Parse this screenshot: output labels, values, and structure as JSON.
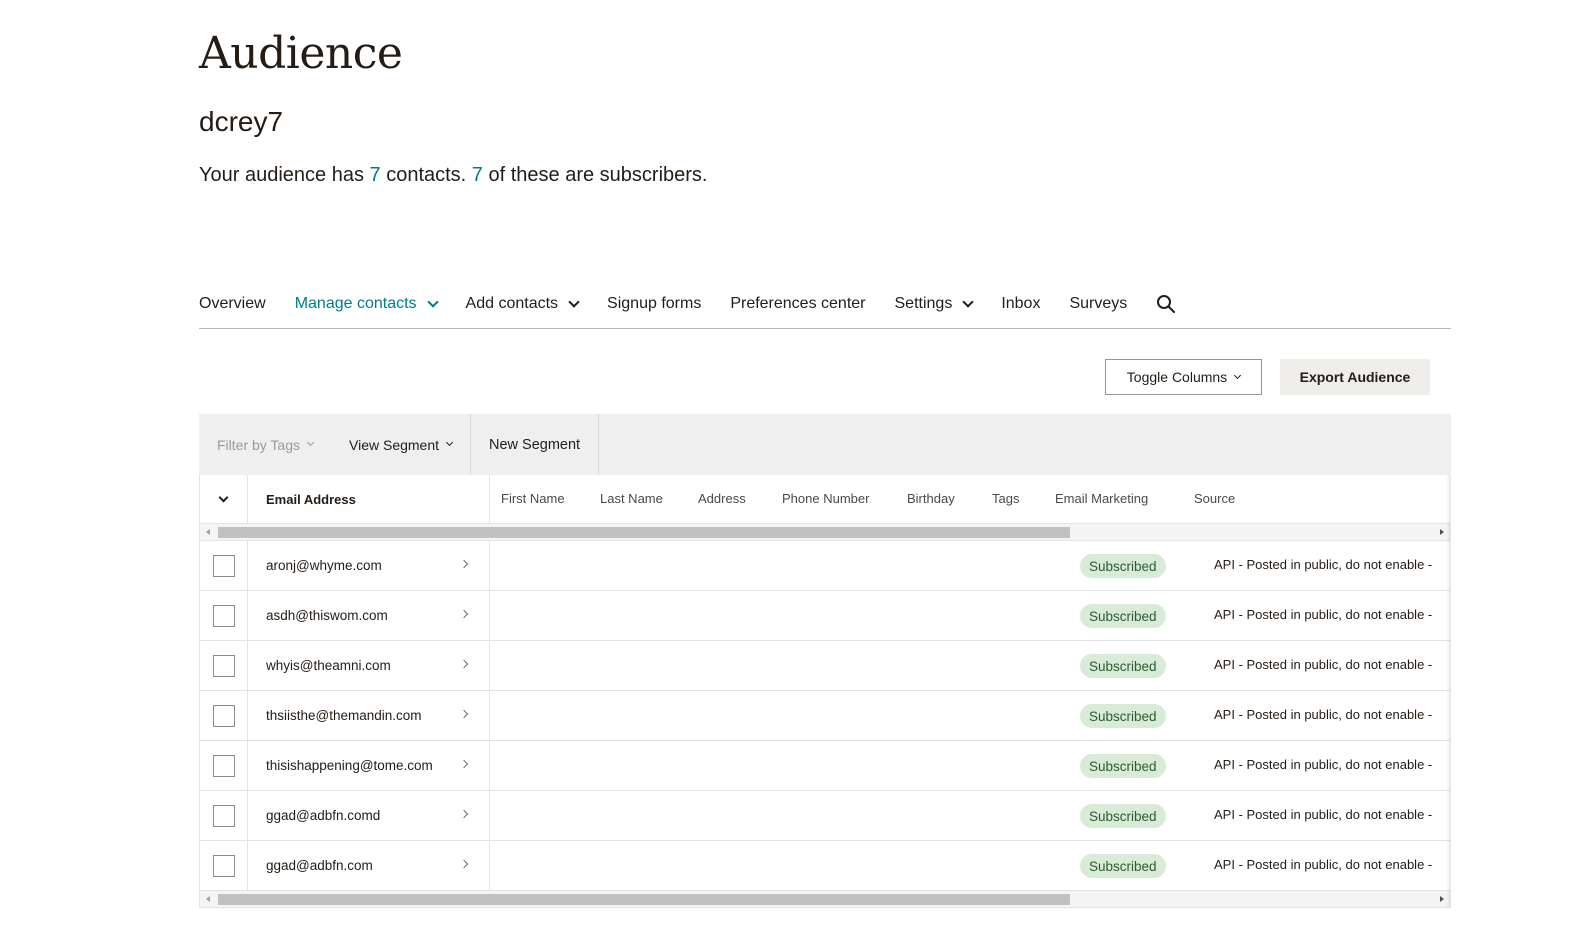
{
  "header": {
    "title": "Audience",
    "audience_name": "dcrey7",
    "summary": {
      "prefix": "Your audience has ",
      "contacts_count": "7",
      "middle": " contacts. ",
      "subscribers_count": "7",
      "suffix": " of these are subscribers."
    },
    "accent_color": "#007c89"
  },
  "nav": {
    "overview": "Overview",
    "manage_contacts": "Manage contacts",
    "add_contacts": "Add contacts",
    "signup_forms": "Signup forms",
    "preferences_center": "Preferences center",
    "settings": "Settings",
    "inbox": "Inbox",
    "surveys": "Surveys",
    "search_icon": "search-icon"
  },
  "toolbar": {
    "toggle_columns": "Toggle Columns",
    "export_audience": "Export Audience"
  },
  "filters": {
    "filter_by_tags": "Filter by Tags",
    "view_segment": "View Segment",
    "new_segment": "New Segment"
  },
  "table": {
    "columns": {
      "email": "Email Address",
      "first_name": "First Name",
      "last_name": "Last Name",
      "address": "Address",
      "phone": "Phone Number",
      "birthday": "Birthday",
      "tags": "Tags",
      "email_marketing": "Email Marketing",
      "source": "Source"
    },
    "rows": [
      {
        "email": "aronj@whyme.com",
        "status": "Subscribed",
        "source": "API - Posted in public, do not enable -"
      },
      {
        "email": "asdh@thiswom.com",
        "status": "Subscribed",
        "source": "API - Posted in public, do not enable -"
      },
      {
        "email": "whyis@theamni.com",
        "status": "Subscribed",
        "source": "API - Posted in public, do not enable -"
      },
      {
        "email": "thsiisthe@themandin.com",
        "status": "Subscribed",
        "source": "API - Posted in public, do not enable -"
      },
      {
        "email": "thisishappening@tome.com",
        "status": "Subscribed",
        "source": "API - Posted in public, do not enable -"
      },
      {
        "email": "ggad@adbfn.comd",
        "status": "Subscribed",
        "source": "API - Posted in public, do not enable -"
      },
      {
        "email": "ggad@adbfn.com",
        "status": "Subscribed",
        "source": "API - Posted in public, do not enable -"
      }
    ],
    "status_color": "#d7ebd7"
  }
}
